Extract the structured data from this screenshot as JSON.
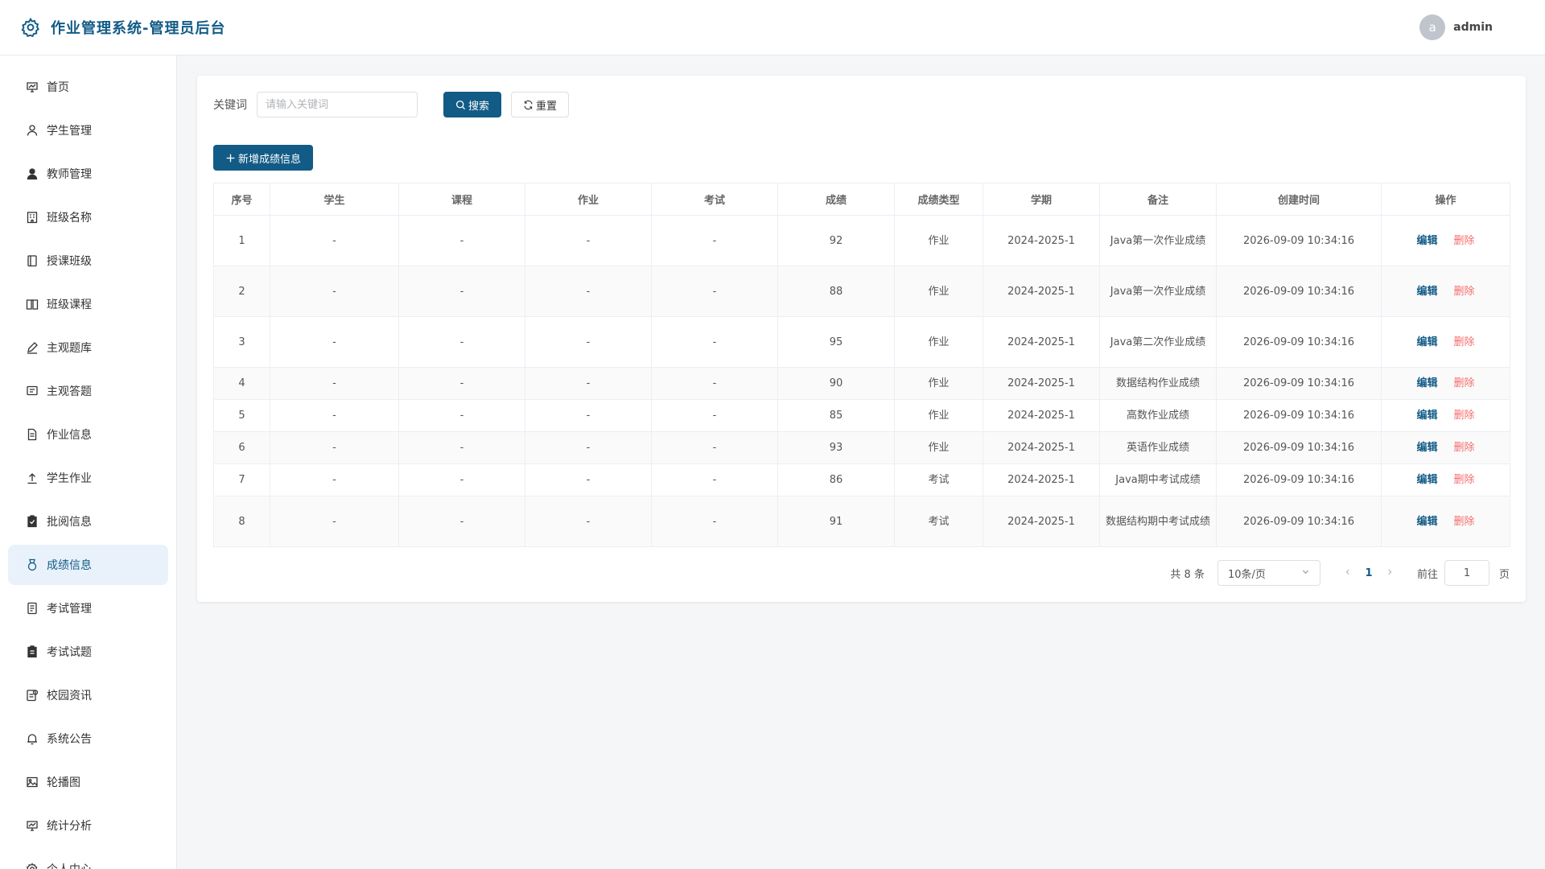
{
  "header": {
    "title": "作业管理系统-管理员后台",
    "avatar_letter": "a",
    "username": "admin"
  },
  "sidebar": {
    "items": [
      {
        "label": "首页",
        "icon": "home-chart-icon"
      },
      {
        "label": "学生管理",
        "icon": "user-icon"
      },
      {
        "label": "教师管理",
        "icon": "user-filled-icon"
      },
      {
        "label": "班级名称",
        "icon": "building-icon"
      },
      {
        "label": "授课班级",
        "icon": "notebook-icon"
      },
      {
        "label": "班级课程",
        "icon": "book-icon"
      },
      {
        "label": "主观题库",
        "icon": "pen-icon"
      },
      {
        "label": "主观答题",
        "icon": "message-icon"
      },
      {
        "label": "作业信息",
        "icon": "document-icon"
      },
      {
        "label": "学生作业",
        "icon": "upload-icon"
      },
      {
        "label": "批阅信息",
        "icon": "checklist-icon"
      },
      {
        "label": "成绩信息",
        "icon": "medal-icon"
      },
      {
        "label": "考试管理",
        "icon": "tickets-icon"
      },
      {
        "label": "考试试题",
        "icon": "clipboard-icon"
      },
      {
        "label": "校园资讯",
        "icon": "news-icon"
      },
      {
        "label": "系统公告",
        "icon": "bell-icon"
      },
      {
        "label": "轮播图",
        "icon": "picture-icon"
      },
      {
        "label": "统计分析",
        "icon": "stats-icon"
      },
      {
        "label": "个人中心",
        "icon": "gear-icon"
      }
    ],
    "active_index": 11
  },
  "search": {
    "label": "关键词",
    "placeholder": "请输入关键词",
    "search_label": "搜索",
    "reset_label": "重置"
  },
  "toolbar": {
    "add_label": "新增成绩信息"
  },
  "table": {
    "headers": [
      "序号",
      "学生",
      "课程",
      "作业",
      "考试",
      "成绩",
      "成绩类型",
      "学期",
      "备注",
      "创建时间",
      "操作"
    ],
    "edit_label": "编辑",
    "delete_label": "删除",
    "rows": [
      {
        "no": "1",
        "student": "-",
        "course": "-",
        "homework": "-",
        "exam": "-",
        "score": "92",
        "type": "作业",
        "term": "2024-2025-1",
        "remark": "Java第一次作业成绩",
        "created": "2026-09-09 10:34:16",
        "tall": true
      },
      {
        "no": "2",
        "student": "-",
        "course": "-",
        "homework": "-",
        "exam": "-",
        "score": "88",
        "type": "作业",
        "term": "2024-2025-1",
        "remark": "Java第一次作业成绩",
        "created": "2026-09-09 10:34:16",
        "tall": true
      },
      {
        "no": "3",
        "student": "-",
        "course": "-",
        "homework": "-",
        "exam": "-",
        "score": "95",
        "type": "作业",
        "term": "2024-2025-1",
        "remark": "Java第二次作业成绩",
        "created": "2026-09-09 10:34:16",
        "tall": true
      },
      {
        "no": "4",
        "student": "-",
        "course": "-",
        "homework": "-",
        "exam": "-",
        "score": "90",
        "type": "作业",
        "term": "2024-2025-1",
        "remark": "数据结构作业成绩",
        "created": "2026-09-09 10:34:16",
        "tall": false
      },
      {
        "no": "5",
        "student": "-",
        "course": "-",
        "homework": "-",
        "exam": "-",
        "score": "85",
        "type": "作业",
        "term": "2024-2025-1",
        "remark": "高数作业成绩",
        "created": "2026-09-09 10:34:16",
        "tall": false
      },
      {
        "no": "6",
        "student": "-",
        "course": "-",
        "homework": "-",
        "exam": "-",
        "score": "93",
        "type": "作业",
        "term": "2024-2025-1",
        "remark": "英语作业成绩",
        "created": "2026-09-09 10:34:16",
        "tall": false
      },
      {
        "no": "7",
        "student": "-",
        "course": "-",
        "homework": "-",
        "exam": "-",
        "score": "86",
        "type": "考试",
        "term": "2024-2025-1",
        "remark": "Java期中考试成绩",
        "created": "2026-09-09 10:34:16",
        "tall": false
      },
      {
        "no": "8",
        "student": "-",
        "course": "-",
        "homework": "-",
        "exam": "-",
        "score": "91",
        "type": "考试",
        "term": "2024-2025-1",
        "remark": "数据结构期中考试成绩",
        "created": "2026-09-09 10:34:16",
        "tall": true
      }
    ]
  },
  "pagination": {
    "total_text": "共 8 条",
    "page_size": "10条/页",
    "current_page": "1",
    "goto_label": "前往",
    "goto_value": "1",
    "page_suffix": "页"
  }
}
